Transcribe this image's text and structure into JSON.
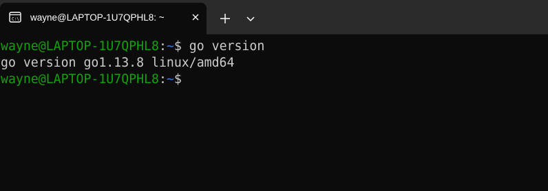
{
  "tab": {
    "title": "wayne@LAPTOP-1U7QPHL8: ~",
    "icon": "terminal-icon",
    "close_icon": "close-icon"
  },
  "tabbar": {
    "new_tab_icon": "plus-icon",
    "dropdown_icon": "chevron-down-icon"
  },
  "colors": {
    "tabbar_bg": "#2b2b2b",
    "terminal_bg": "#0c0c0c",
    "prompt_user": "#13a10e",
    "prompt_path": "#3b78ff",
    "text": "#cccccc"
  },
  "terminal": {
    "lines": [
      {
        "user": "wayne@LAPTOP-1U7QPHL8",
        "sep": ":",
        "path": "~",
        "symbol": "$ ",
        "command": "go version"
      },
      {
        "output": "go version go1.13.8 linux/amd64"
      },
      {
        "user": "wayne@LAPTOP-1U7QPHL8",
        "sep": ":",
        "path": "~",
        "symbol": "$",
        "command": ""
      }
    ]
  }
}
